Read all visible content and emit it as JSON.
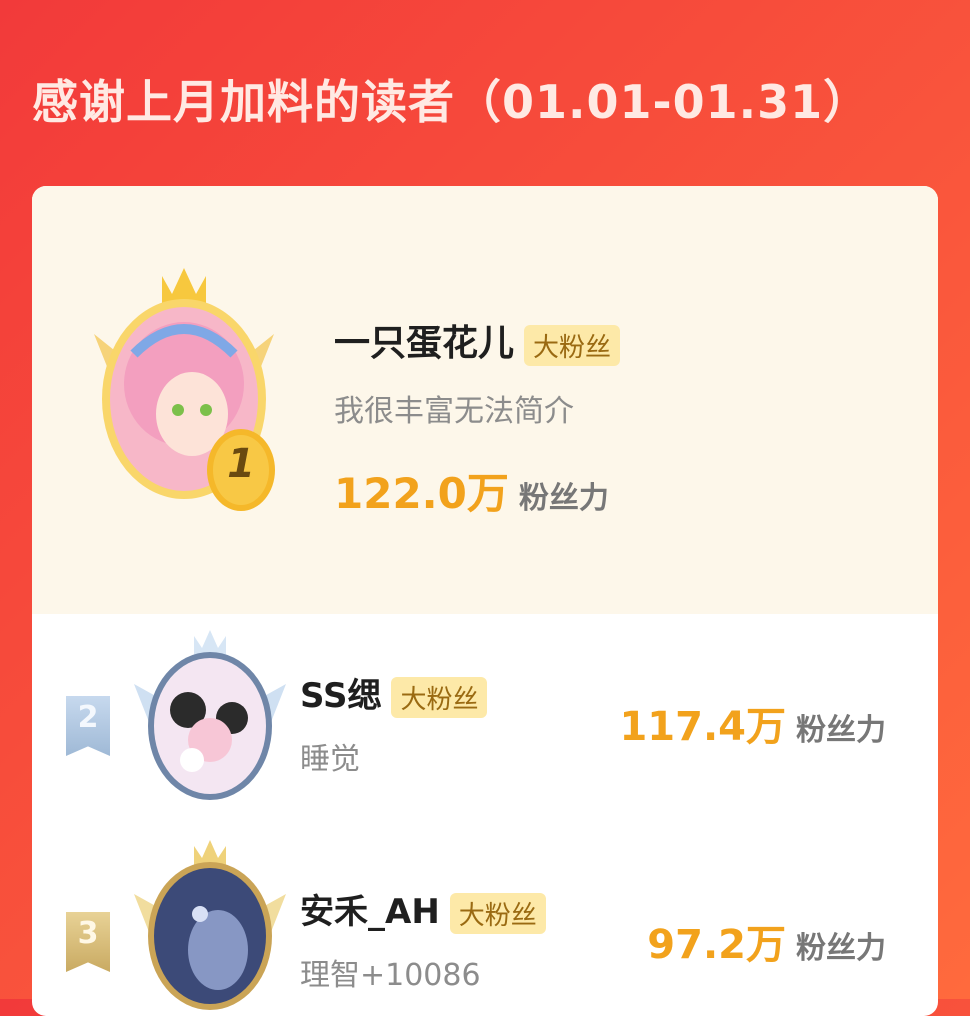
{
  "header": {
    "title": "感谢上月加料的读者（01.01-01.31）"
  },
  "readers": [
    {
      "rank": "1",
      "name": "一只蛋花儿",
      "tag": "大粉丝",
      "bio": "我很丰富无法简介",
      "power": "122.0万",
      "power_unit": "粉丝力"
    },
    {
      "rank": "2",
      "name": "SS缌",
      "tag": "大粉丝",
      "bio": "睡觉",
      "power": "117.4万",
      "power_unit": "粉丝力"
    },
    {
      "rank": "3",
      "name": "安禾_AH",
      "tag": "大粉丝",
      "bio": "理智+10086",
      "power": "97.2万",
      "power_unit": "粉丝力"
    }
  ],
  "colors": {
    "accent": "#f2a21c",
    "background": "#f23a3a",
    "tag_bg": "#fde9a8"
  }
}
